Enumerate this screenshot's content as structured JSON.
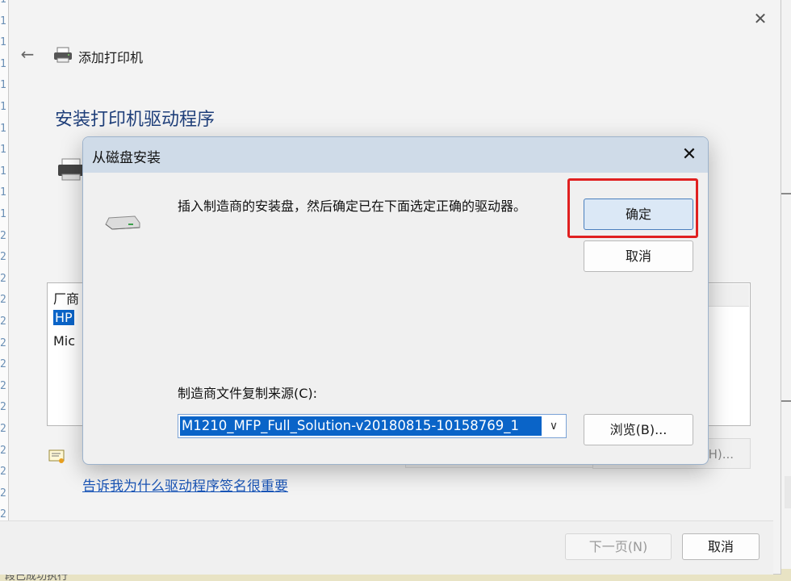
{
  "background": {
    "line_numbers": [
      "1",
      "1",
      "1",
      "1",
      "1",
      "1",
      "1",
      "1",
      "1",
      "1",
      "1",
      "2",
      "2",
      "2",
      "2",
      "2",
      "2",
      "2",
      "2",
      "2",
      "2",
      "2",
      "2",
      "2",
      "2",
      "2",
      "2",
      "2",
      "2"
    ],
    "bottom_text": "段已成功执行"
  },
  "wizard": {
    "title": "添加打印机",
    "heading": "安装打印机驱动程序",
    "list_items": [
      "厂商",
      "HP",
      "Mic"
    ],
    "partial_button_text": "H)...",
    "link": "告诉我为什么驱动程序签名很重要",
    "next_button": "下一页(N)",
    "cancel_button": "取消"
  },
  "dialog": {
    "title": "从磁盘安装",
    "message": "插入制造商的安装盘，然后确定已在下面选定正确的驱动器。",
    "ok_button": "确定",
    "cancel_button": "取消",
    "source_label": "制造商文件复制来源(C):",
    "source_value": "M1210_MFP_Full_Solution-v20180815-10158769_1",
    "browse_button": "浏览(B)...",
    "caret_icon": "chevron-down-icon",
    "highlight_color": "#e02020"
  }
}
